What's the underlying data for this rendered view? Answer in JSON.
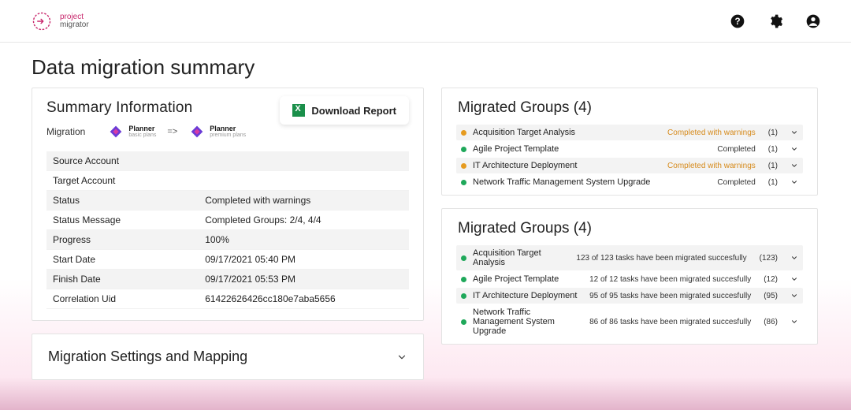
{
  "brand": {
    "line1": "project",
    "line2": "migrator"
  },
  "page_title": "Data migration summary",
  "summary": {
    "title": "Summary Information",
    "download_label": "Download Report",
    "migration_label": "Migration",
    "arrow": "=>",
    "source_badge": {
      "name": "Planner",
      "tier": "basic plans"
    },
    "target_badge": {
      "name": "Planner",
      "tier": "premium plans"
    },
    "rows": [
      {
        "k": "Source Account",
        "v": ""
      },
      {
        "k": "Target Account",
        "v": ""
      },
      {
        "k": "Status",
        "v": "Completed with warnings"
      },
      {
        "k": "Status Message",
        "v": "Completed Groups: 2/4, 4/4"
      },
      {
        "k": "Progress",
        "v": "100%"
      },
      {
        "k": "Start Date",
        "v": "09/17/2021 05:40 PM"
      },
      {
        "k": "Finish Date",
        "v": "09/17/2021 05:53 PM"
      },
      {
        "k": "Correlation Uid",
        "v": "61422626426cc180e7aba5656"
      }
    ]
  },
  "settings_panel_title": "Migration Settings and Mapping",
  "groups_a": {
    "title": "Migrated Groups (4)",
    "items": [
      {
        "dot": "orange",
        "name": "Acquisition Target Analysis",
        "status": "Completed with warnings",
        "warn": true,
        "count": "(1)"
      },
      {
        "dot": "green",
        "name": "Agile Project Template",
        "status": "Completed",
        "warn": false,
        "count": "(1)"
      },
      {
        "dot": "orange",
        "name": "IT Architecture Deployment",
        "status": "Completed with warnings",
        "warn": true,
        "count": "(1)"
      },
      {
        "dot": "green",
        "name": "Network Traffic Management System Upgrade",
        "status": "Completed",
        "warn": false,
        "count": "(1)"
      }
    ]
  },
  "groups_b": {
    "title": "Migrated Groups (4)",
    "items": [
      {
        "dot": "green",
        "name": "Acquisition Target Analysis",
        "status": "123 of 123 tasks have been migrated succesfully",
        "warn": false,
        "count": "(123)"
      },
      {
        "dot": "green",
        "name": "Agile Project Template",
        "status": "12 of 12 tasks have been migrated succesfully",
        "warn": false,
        "count": "(12)"
      },
      {
        "dot": "green",
        "name": "IT Architecture Deployment",
        "status": "95 of 95 tasks have been migrated succesfully",
        "warn": false,
        "count": "(95)"
      },
      {
        "dot": "green",
        "name": "Network Traffic Management System Upgrade",
        "status": "86 of 86 tasks have been migrated succesfully",
        "warn": false,
        "count": "(86)"
      }
    ]
  },
  "colors": {
    "warn": "#d68a1b",
    "ok": "#1fa85a"
  }
}
